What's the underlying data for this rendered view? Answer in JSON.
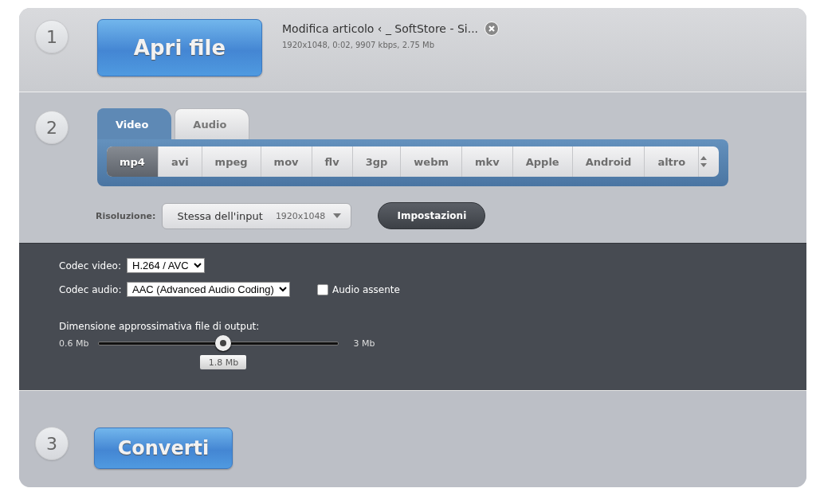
{
  "steps": [
    {
      "number": "1"
    },
    {
      "number": "2"
    },
    {
      "number": "3"
    }
  ],
  "open_button": {
    "label": "Apri file"
  },
  "file": {
    "name": "Modifica articolo ‹ _ SoftStore - Si...",
    "details": "1920x1048, 0:02, 9907 kbps, 2.75 Mb"
  },
  "tabs": [
    {
      "label": "Video",
      "selected": true
    },
    {
      "label": "Audio",
      "selected": false
    }
  ],
  "formats": [
    {
      "label": "mp4",
      "selected": true
    },
    {
      "label": "avi",
      "selected": false
    },
    {
      "label": "mpeg",
      "selected": false
    },
    {
      "label": "mov",
      "selected": false
    },
    {
      "label": "flv",
      "selected": false
    },
    {
      "label": "3gp",
      "selected": false
    },
    {
      "label": "webm",
      "selected": false
    },
    {
      "label": "mkv",
      "selected": false
    },
    {
      "label": "Apple",
      "selected": false
    },
    {
      "label": "Android",
      "selected": false
    },
    {
      "label": "altro",
      "selected": false
    }
  ],
  "resolution": {
    "label": "Risoluzione:",
    "value": "Stessa dell'input",
    "size": "1920x1048"
  },
  "settings_button": {
    "label": "Impostazioni"
  },
  "settings": {
    "video_codec": {
      "label": "Codec video:",
      "value": "H.264 / AVC"
    },
    "audio_codec": {
      "label": "Codec audio:",
      "value": "AAC (Advanced Audio Coding)"
    },
    "no_audio": {
      "label": "Audio assente",
      "checked": false
    },
    "size": {
      "label": "Dimensione approssimativa file di output:",
      "min": "0.6 Mb",
      "max": "3 Mb",
      "reading": "1.8 Mb",
      "level": 0.52
    }
  },
  "convert_button": {
    "label": "Converti"
  }
}
